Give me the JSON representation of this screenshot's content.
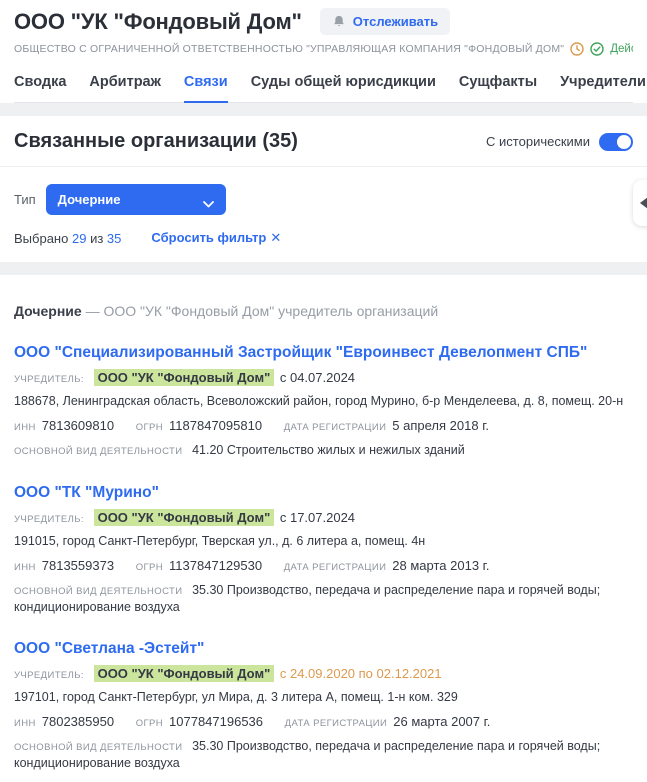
{
  "colors": {
    "accent": "#2E6BF0",
    "founder_highlight": "#CBE59C",
    "historical_period": "#DD9A4E",
    "status_green": "#3FA45C",
    "clock_orange": "#DD9A4E"
  },
  "header": {
    "title": "ООО \"УК \"Фондовый Дом\"",
    "track_button": "Отслеживать",
    "full_name": "ОБЩЕСТВО С ОГРАНИЧЕННОЙ ОТВЕТСТВЕННОСТЬЮ \"УПРАВЛЯЮЩАЯ КОМПАНИЯ \"ФОНДОВЫЙ ДОМ\"",
    "status": "Действующая организация"
  },
  "tabs": [
    {
      "label": "Сводка"
    },
    {
      "label": "Арбитраж"
    },
    {
      "label": "Связи",
      "active": true
    },
    {
      "label": "Суды общей юрисдикции"
    },
    {
      "label": "Сущфакты"
    },
    {
      "label": "Учредители"
    }
  ],
  "related": {
    "title": "Связанные организации (35)",
    "historical_toggle_label": "С историческими",
    "historical_toggle_on": true,
    "filter_label": "Тип",
    "filter_value": "Дочерние",
    "selected_prefix": "Выбрано",
    "selected_count": "29",
    "selected_of": "из",
    "selected_total": "35",
    "clear_filter": "Сбросить фильтр",
    "clear_filter_icon": "✕"
  },
  "list": {
    "heading_bold": "Дочерние",
    "heading_rest": "— ООО \"УК \"Фондовый Дом\" учредитель организаций",
    "labels": {
      "founder": "УЧРЕДИТЕЛЬ:",
      "inn": "ИНН",
      "ogrn": "ОГРН",
      "reg_date": "ДАТА РЕГИСТРАЦИИ",
      "activity": "ОСНОВНОЙ ВИД ДЕЯТЕЛЬНОСТИ"
    },
    "companies": [
      {
        "name": "ООО \"Специализированный Застройщик \"Евроинвест Девелопмент СПБ\"",
        "founder": "ООО \"УК \"Фондовый Дом\"",
        "founder_period": "с 04.07.2024",
        "address": "188678, Ленинградская область, Всеволожский район, город Мурино, б-р Менделеева, д. 8, помещ. 20-н",
        "inn": "7813609810",
        "ogrn": "1187847095810",
        "reg_date": "5 апреля 2018 г.",
        "activity": "41.20 Строительство жилых и нежилых зданий"
      },
      {
        "name": "ООО \"ТК \"Мурино\"",
        "founder": "ООО \"УК \"Фондовый Дом\"",
        "founder_period": "с 17.07.2024",
        "address": "191015, город Санкт-Петербург, Тверская ул., д. 6 литера а, помещ. 4н",
        "inn": "7813559373",
        "ogrn": "1137847129530",
        "reg_date": "28 марта 2013 г.",
        "activity": "35.30 Производство, передача и распределение пара и горячей воды; кондиционирование воздуха"
      },
      {
        "name": "ООО \"Светлана -Эстейт\"",
        "founder": "ООО \"УК \"Фондовый Дом\"",
        "founder_period": "с 24.09.2020 по 02.12.2021",
        "address": "197101, город Санкт-Петербург, ул Мира, д. 3 литера А, помещ. 1-н ком. 329",
        "inn": "7802385950",
        "ogrn": "1077847196536",
        "reg_date": "26 марта 2007 г.",
        "activity": "35.30 Производство, передача и распределение пара и горячей воды; кондиционирование воздуха"
      }
    ]
  }
}
